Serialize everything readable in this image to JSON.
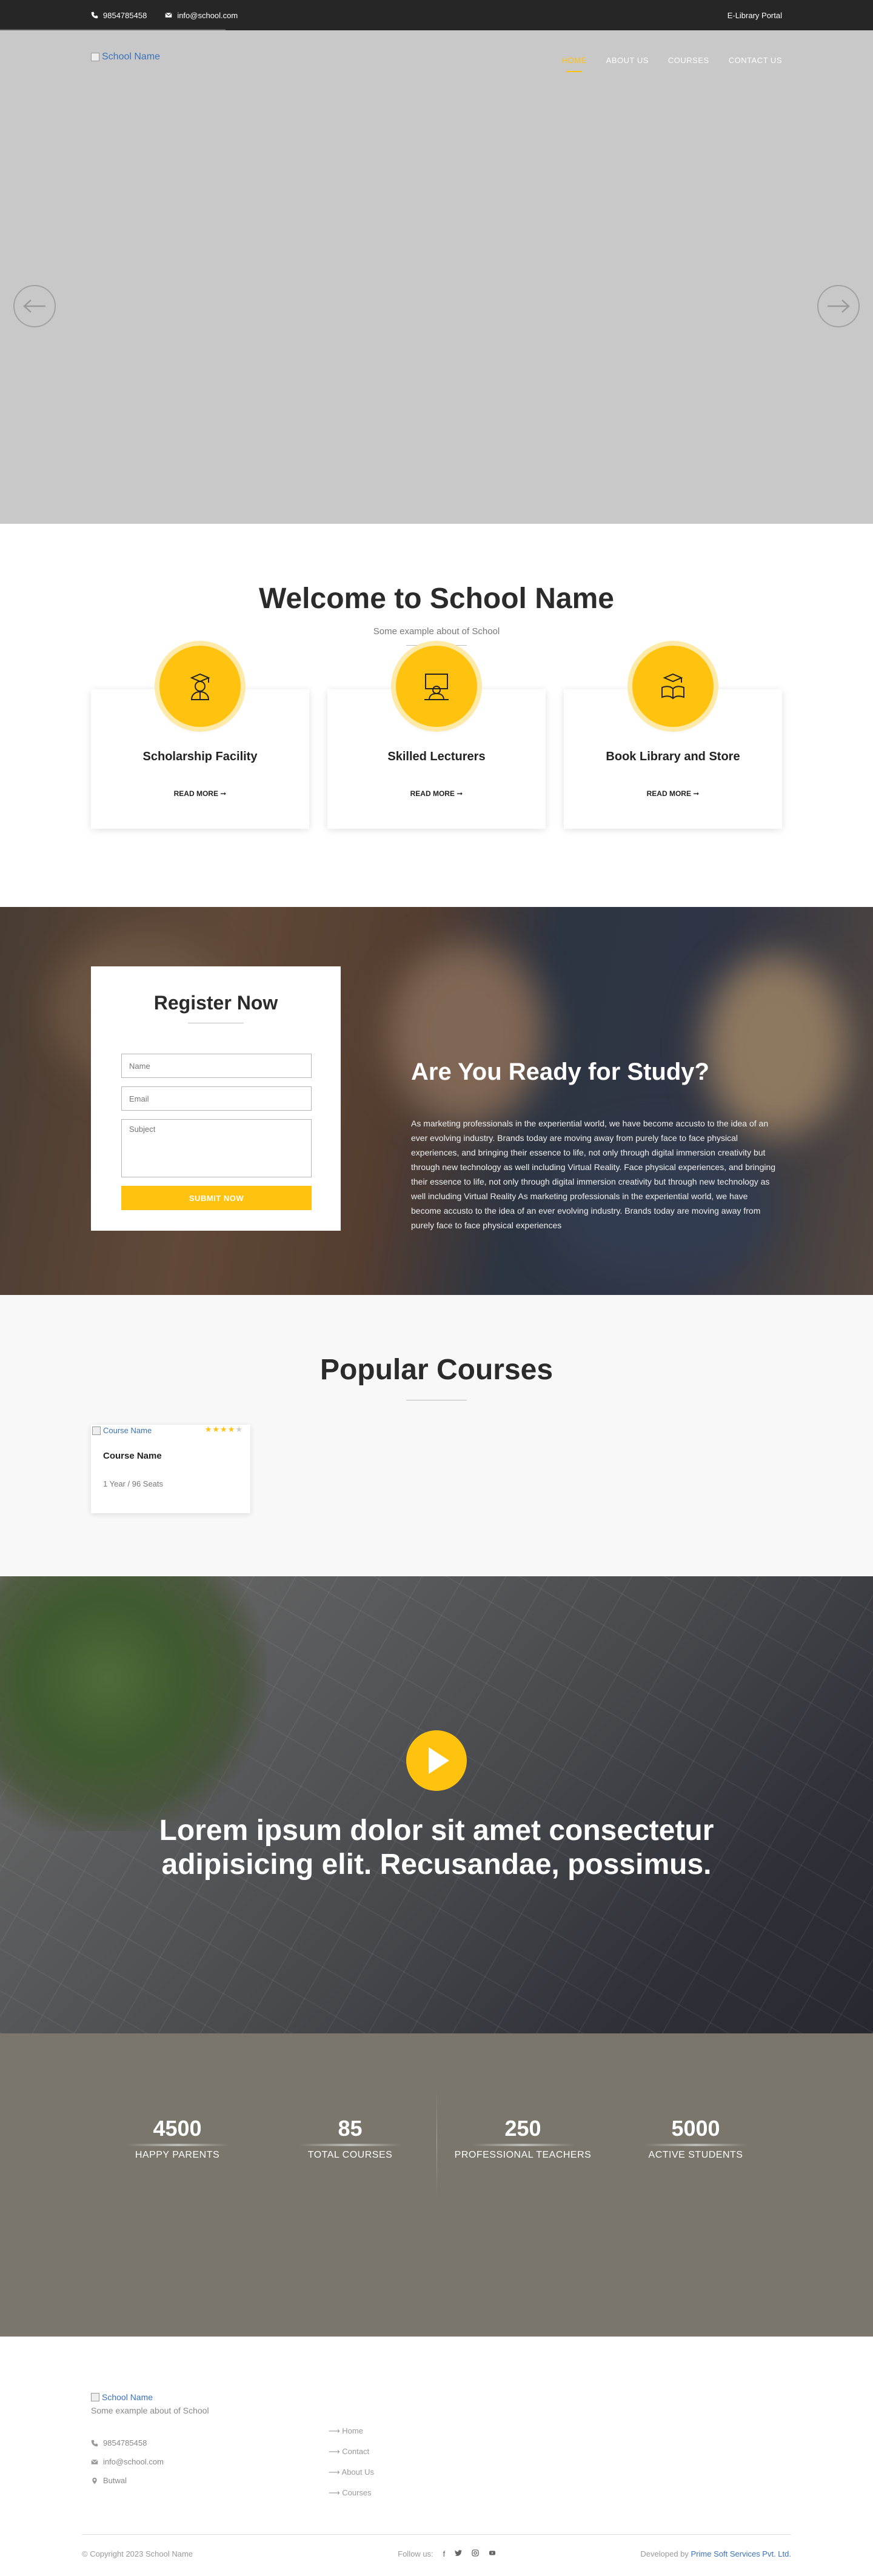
{
  "topbar": {
    "phone": "9854785458",
    "email": "info@school.com",
    "portal_link": "E-Library Portal"
  },
  "header": {
    "logo_alt": "School Name",
    "nav": [
      {
        "label": "HOME",
        "active": true
      },
      {
        "label": "ABOUT US",
        "active": false
      },
      {
        "label": "COURSES",
        "active": false
      },
      {
        "label": "CONTACT US",
        "active": false
      }
    ]
  },
  "slider": {
    "prev_icon": "arrow-left-icon",
    "next_icon": "arrow-right-icon"
  },
  "welcome": {
    "title": "Welcome to School Name",
    "subtitle": "Some example about of School",
    "features": [
      {
        "title": "Scholarship Facility",
        "link": "READ MORE ➞",
        "icon": "graduate-icon"
      },
      {
        "title": "Skilled Lecturers",
        "link": "READ MORE ➞",
        "icon": "lecturer-icon"
      },
      {
        "title": "Book Library and Store",
        "link": "READ MORE ➞",
        "icon": "books-icon"
      }
    ]
  },
  "register": {
    "title": "Register Now",
    "name_placeholder": "Name",
    "email_placeholder": "Email",
    "subject_placeholder": "Subject",
    "submit_label": "SUBMIT NOW"
  },
  "study": {
    "title": "Are You Ready for Study?",
    "body": "As marketing professionals in the experiential world, we have become accusto to the idea of an ever evolving industry. Brands today are moving away from purely face to face physical experiences, and bringing their essence to life, not only through digital immersion creativity but through new technology as well including Virtual Reality. Face physical experiences, and bringing their essence to life, not only through digital immersion creativity but through new technology as well including Virtual Reality As marketing professionals in the experiential world, we have become accusto to the idea of an ever evolving industry. Brands today are moving away from purely face to face physical experiences"
  },
  "courses": {
    "title": "Popular Courses",
    "items": [
      {
        "img_alt": "Course Name",
        "name": "Course Name",
        "meta": "1 Year / 96 Seats",
        "rating": 4
      }
    ]
  },
  "video": {
    "headline": "Lorem ipsum dolor sit amet consectetur adipisicing elit. Recusandae, possimus."
  },
  "stats": [
    {
      "value": "4500",
      "label": "HAPPY PARENTS"
    },
    {
      "value": "85",
      "label": "TOTAL COURSES"
    },
    {
      "value": "250",
      "label": "PROFESSIONAL TEACHERS"
    },
    {
      "value": "5000",
      "label": "ACTIVE STUDENTS"
    }
  ],
  "footer": {
    "logo_alt": "School Name",
    "subtitle": "Some example about of School",
    "phone": "9854785458",
    "email": "info@school.com",
    "address": "Butwal",
    "links": [
      "Home",
      "Contact",
      "About Us",
      "Courses"
    ],
    "copyright": "© Copyright 2023 School Name",
    "follow_label": "Follow us:",
    "dev_prefix": "Developed by",
    "dev_name": "Prime Soft Services Pvt. Ltd."
  },
  "colors": {
    "accent": "#ffc20e",
    "dark": "#262626",
    "link": "#3a72b8"
  }
}
